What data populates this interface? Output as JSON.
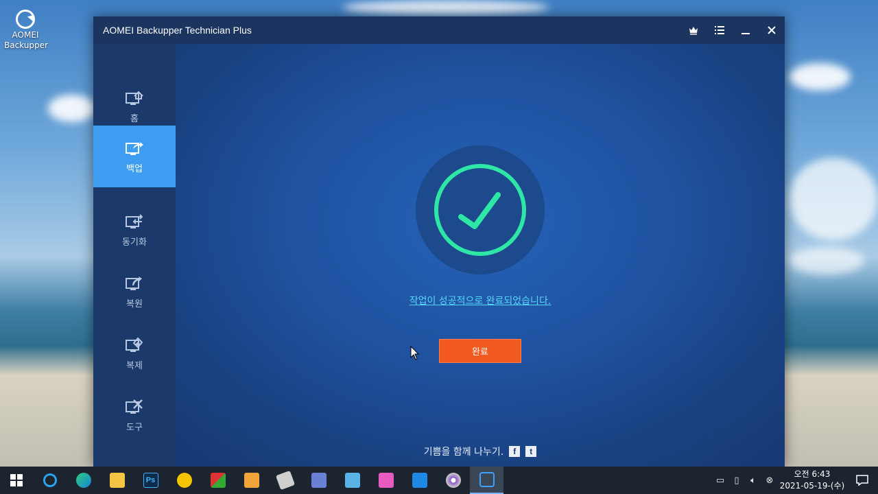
{
  "desktop": {
    "icon_line1": "AOMEI",
    "icon_line2": "Backupper"
  },
  "window": {
    "title": "AOMEI Backupper Technician Plus"
  },
  "sidebar": {
    "items": [
      {
        "label": "홈",
        "icon": "home-icon"
      },
      {
        "label": "백업",
        "icon": "backup-icon",
        "active": true
      },
      {
        "label": "동기화",
        "icon": "sync-icon"
      },
      {
        "label": "복원",
        "icon": "restore-icon"
      },
      {
        "label": "복제",
        "icon": "clone-icon"
      },
      {
        "label": "도구",
        "icon": "tools-icon"
      }
    ]
  },
  "main": {
    "success_text": "작업이 성공적으로 완료되었습니다.",
    "done_label": "완료",
    "share_text": "기쁨을 함께 나누기.",
    "facebook_glyph": "f",
    "twitter_glyph": "t"
  },
  "colors": {
    "accent": "#3e9df1",
    "done_button": "#f25a1f",
    "check": "#2ee6a6",
    "link": "#55d6ff"
  },
  "taskbar": {
    "apps": [
      "internet-explorer-icon",
      "edge-icon",
      "file-explorer-icon",
      "photoshop-icon",
      "app-triangle-icon",
      "app-green-icon",
      "app-search-icon",
      "app-drive-icon",
      "app-mouse-icon",
      "app-tool-icon",
      "app-tiles-icon",
      "app-network-icon",
      "app-disc-icon",
      "aomei-backupper-icon"
    ],
    "photoshop_label": "Ps",
    "clock_time": "오전 6:43",
    "clock_date": "2021-05-19-(수)"
  }
}
